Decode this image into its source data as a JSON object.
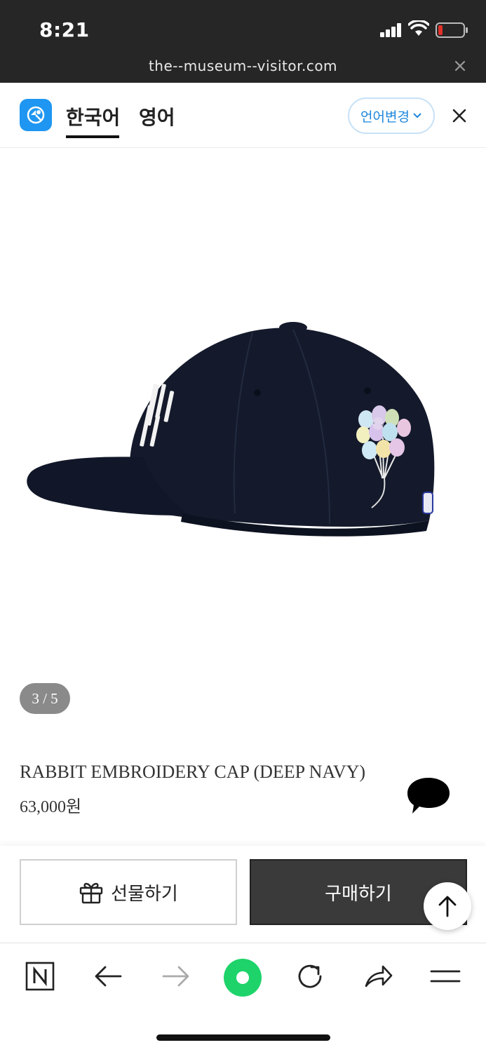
{
  "status_bar": {
    "time": "8:21",
    "icons": [
      "cellular-signal-icon",
      "wifi-icon",
      "low-battery-icon"
    ],
    "battery_color": "#e0302a"
  },
  "url_bar": {
    "url": "the--museum--visitor.com",
    "close_icon": "close-icon"
  },
  "language_bar": {
    "logo_icon": "translate-app-icon",
    "tabs": [
      {
        "label": "한국어",
        "selected": true
      },
      {
        "label": "영어",
        "selected": false
      }
    ],
    "change_button": "언어변경",
    "accent_color": "#1e96f2"
  },
  "product": {
    "image_description_icon": "cap-with-balloons-image",
    "pager": "3 / 5",
    "title": "RABBIT EMBROIDERY CAP (DEEP NAVY)",
    "price": "63,000원",
    "chat_icon": "speech-bubble-icon"
  },
  "action_bar": {
    "gift_label": "선물하기",
    "buy_label": "구매하기",
    "buy_color": "#3a3a3a"
  },
  "browser_nav": {
    "items": [
      "naver-home-icon",
      "back-arrow-icon",
      "forward-arrow-icon",
      "green-dot-icon",
      "reload-icon",
      "share-icon",
      "menu-icon"
    ],
    "green_color": "#1ed36a"
  }
}
